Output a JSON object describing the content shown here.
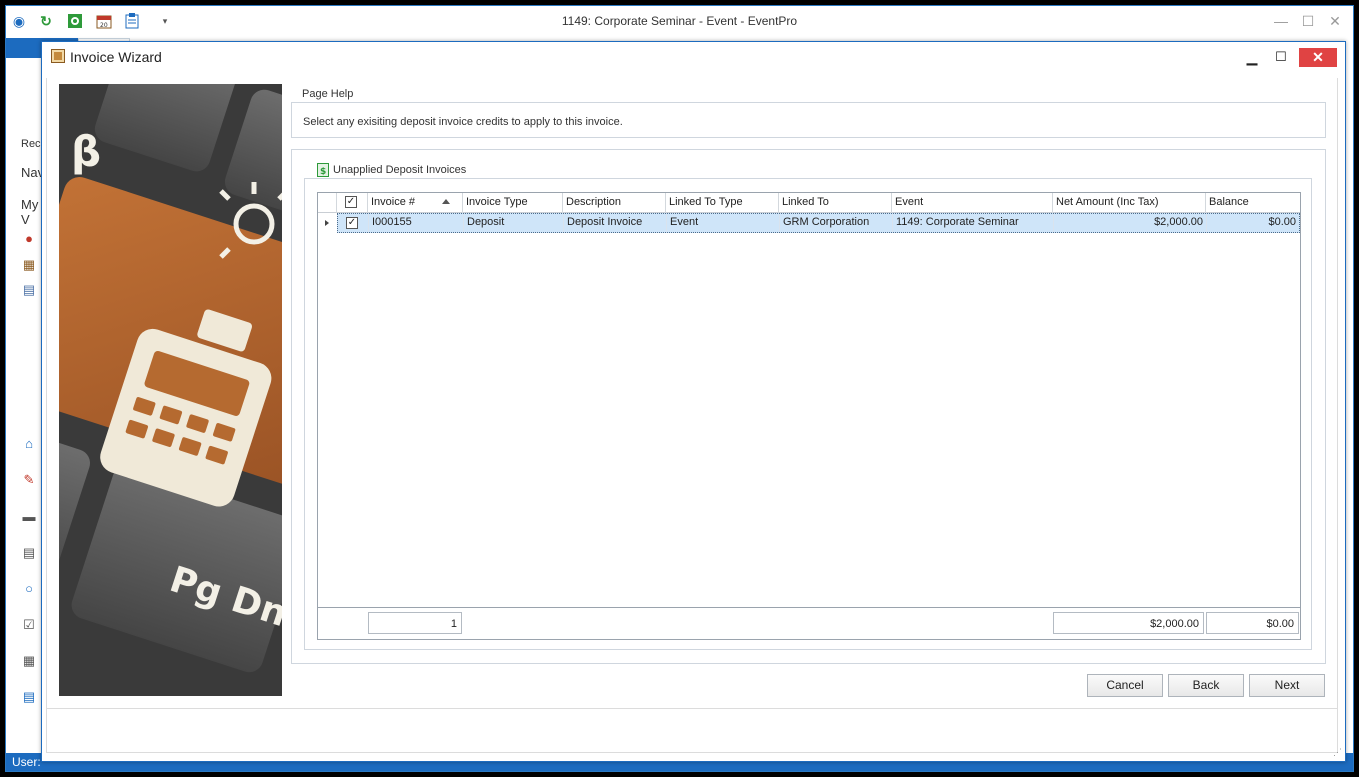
{
  "app": {
    "title": "1149: Corporate Seminar - Event - EventPro",
    "left_labels": [
      "Rec",
      "Nav",
      "My V"
    ],
    "status_text": "User: "
  },
  "dialog": {
    "title": "Invoice Wizard",
    "close_glyph": "✕",
    "page_help": {
      "legend": "Page Help",
      "text": "Select any exisiting deposit invoice credits to apply to this invoice."
    },
    "unapplied": {
      "legend": "Unapplied Deposit Invoices"
    },
    "grid": {
      "columns": [
        "Invoice #",
        "Invoice Type",
        "Description",
        "Linked To Type",
        "Linked To",
        "Event",
        "Net Amount (Inc Tax)",
        "Balance"
      ],
      "rows": [
        {
          "checked": true,
          "invoice_no": "I000155",
          "invoice_type": "Deposit",
          "description": "Deposit Invoice",
          "linked_to_type": "Event",
          "linked_to": "GRM Corporation",
          "event": "1149: Corporate Seminar",
          "net_amount": "$2,000.00",
          "balance": "$0.00"
        }
      ],
      "footer": {
        "count": "1",
        "net_amount_total": "$2,000.00",
        "balance_total": "$0.00"
      }
    },
    "buttons": {
      "cancel": "Cancel",
      "back": "Back",
      "next": "Next"
    },
    "side_art": {
      "keys": [
        "β",
        "Pg Dn E"
      ]
    }
  },
  "colors": {
    "accent": "#1c6bbf",
    "selected_row": "#cfe5f9",
    "close_button": "#e04343",
    "key_orange": "#b5652c"
  }
}
